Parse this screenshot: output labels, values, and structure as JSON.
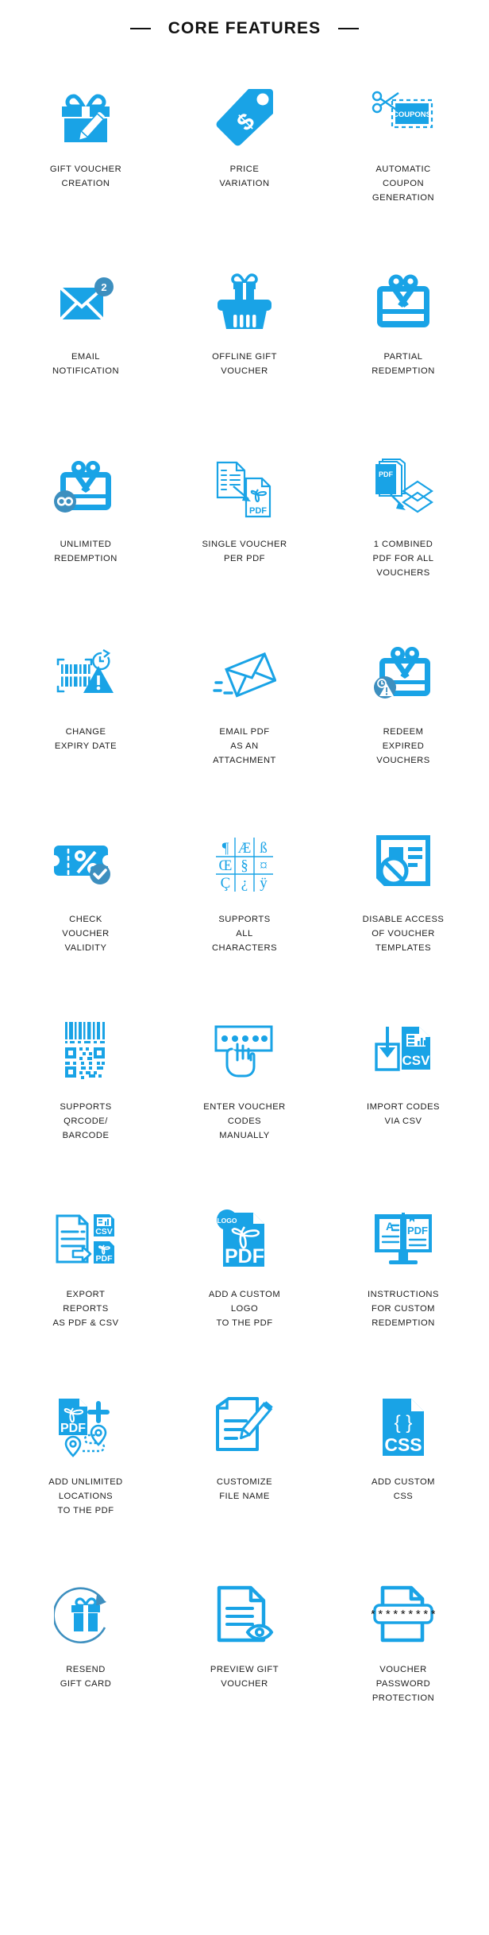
{
  "header": {
    "title": "CORE FEATURES",
    "left_rule": "divider-dash",
    "right_rule": "divider-dash"
  },
  "theme": {
    "accent": "#19a3e6",
    "accent_dark": "#3d8fbf",
    "text": "#1d1d1d",
    "background": "#ffffff"
  },
  "features": [
    {
      "id": "gift-voucher-creation",
      "icon": "gift-box-pencil-icon",
      "label": "GIFT VOUCHER\nCREATION"
    },
    {
      "id": "price-variation",
      "icon": "price-tag-dollar-icon",
      "label": "PRICE\nVARIATION"
    },
    {
      "id": "automatic-coupon-generation",
      "icon": "scissors-coupons-icon",
      "label": "AUTOMATIC\nCOUPON\nGENERATION",
      "icon_text": "COUPONS"
    },
    {
      "id": "email-notification",
      "icon": "envelope-badge-icon",
      "label": "EMAIL\nNOTIFICATION",
      "icon_text": "2"
    },
    {
      "id": "offline-gift-voucher",
      "icon": "basket-gift-icon",
      "label": "OFFLINE GIFT\nVOUCHER"
    },
    {
      "id": "partial-redemption",
      "icon": "gift-card-ribbon-icon",
      "label": "PARTIAL\nREDEMPTION"
    },
    {
      "id": "unlimited-redemption",
      "icon": "gift-card-infinity-icon",
      "label": "UNLIMITED\nREDEMPTION"
    },
    {
      "id": "single-voucher-per-pdf",
      "icon": "document-to-pdf-icon",
      "label": "SINGLE VOUCHER\nPER PDF",
      "icon_text": "PDF"
    },
    {
      "id": "combined-pdf-all-vouchers",
      "icon": "pdf-stack-layers-icon",
      "label": "1 COMBINED\nPDF FOR ALL\nVOUCHERS",
      "icon_text": "PDF"
    },
    {
      "id": "change-expiry-date",
      "icon": "barcode-clock-warning-icon",
      "label": "CHANGE\nEXPIRY DATE"
    },
    {
      "id": "email-pdf-attachment",
      "icon": "flying-envelope-icon",
      "label": "EMAIL PDF\nAS AN\nATTACHMENT"
    },
    {
      "id": "redeem-expired-vouchers",
      "icon": "gift-card-expired-icon",
      "label": "REDEEM\nEXPIRED\nVOUCHERS"
    },
    {
      "id": "check-voucher-validity",
      "icon": "ticket-percent-check-icon",
      "label": "CHECK\nVOUCHER\nVALIDITY"
    },
    {
      "id": "supports-all-characters",
      "icon": "character-grid-icon",
      "label": "SUPPORTS\nALL\nCHARACTERS",
      "icon_chars": [
        "¶",
        "Æ",
        "ß",
        "Œ",
        "§",
        "¤",
        "Ç",
        "¿",
        "ÿ"
      ]
    },
    {
      "id": "disable-access-voucher-templates",
      "icon": "document-blocked-icon",
      "label": "DISABLE ACCESS\nOF VOUCHER\nTEMPLATES"
    },
    {
      "id": "supports-qrcode-barcode",
      "icon": "barcode-qrcode-icon",
      "label": "SUPPORTS\nQRCODE/\nBARCODE"
    },
    {
      "id": "enter-voucher-codes-manually",
      "icon": "hand-keypad-icon",
      "label": "ENTER VOUCHER\nCODES\nMANUALLY"
    },
    {
      "id": "import-codes-via-csv",
      "icon": "download-csv-icon",
      "label": "IMPORT CODES\nVIA CSV",
      "icon_text": "CSV"
    },
    {
      "id": "export-reports-pdf-csv",
      "icon": "export-report-files-icon",
      "label": "EXPORT\nREPORTS\nAS PDF & CSV",
      "icon_text": "CSV / PDF"
    },
    {
      "id": "add-custom-logo-to-pdf",
      "icon": "pdf-logo-badge-icon",
      "label": "ADD A CUSTOM\nLOGO\nTO THE PDF",
      "icon_text": "PDF",
      "icon_badge": "LOGO"
    },
    {
      "id": "instructions-for-custom-redemption",
      "icon": "monitor-book-pdf-icon",
      "label": "INSTRUCTIONS\nFOR CUSTOM\nREDEMPTION",
      "icon_text": "PDF",
      "icon_badge": "A"
    },
    {
      "id": "add-unlimited-locations-to-pdf",
      "icon": "pdf-plus-map-pins-icon",
      "label": "ADD UNLIMITED\nLOCATIONS\nTO THE PDF",
      "icon_text": "PDF"
    },
    {
      "id": "customize-file-name",
      "icon": "document-pencil-icon",
      "label": "CUSTOMIZE\nFILE NAME"
    },
    {
      "id": "add-custom-css",
      "icon": "css-file-icon",
      "label": "ADD CUSTOM\nCSS",
      "icon_text": "CSS",
      "icon_badge": "{ }"
    },
    {
      "id": "resend-gift-card",
      "icon": "gift-refresh-icon",
      "label": "RESEND\nGIFT CARD"
    },
    {
      "id": "preview-gift-voucher",
      "icon": "document-eye-icon",
      "label": "PREVIEW GIFT\nVOUCHER"
    },
    {
      "id": "voucher-password-protection",
      "icon": "document-password-icon",
      "label": "VOUCHER\nPASSWORD\nPROTECTION",
      "icon_text": "***********"
    }
  ]
}
